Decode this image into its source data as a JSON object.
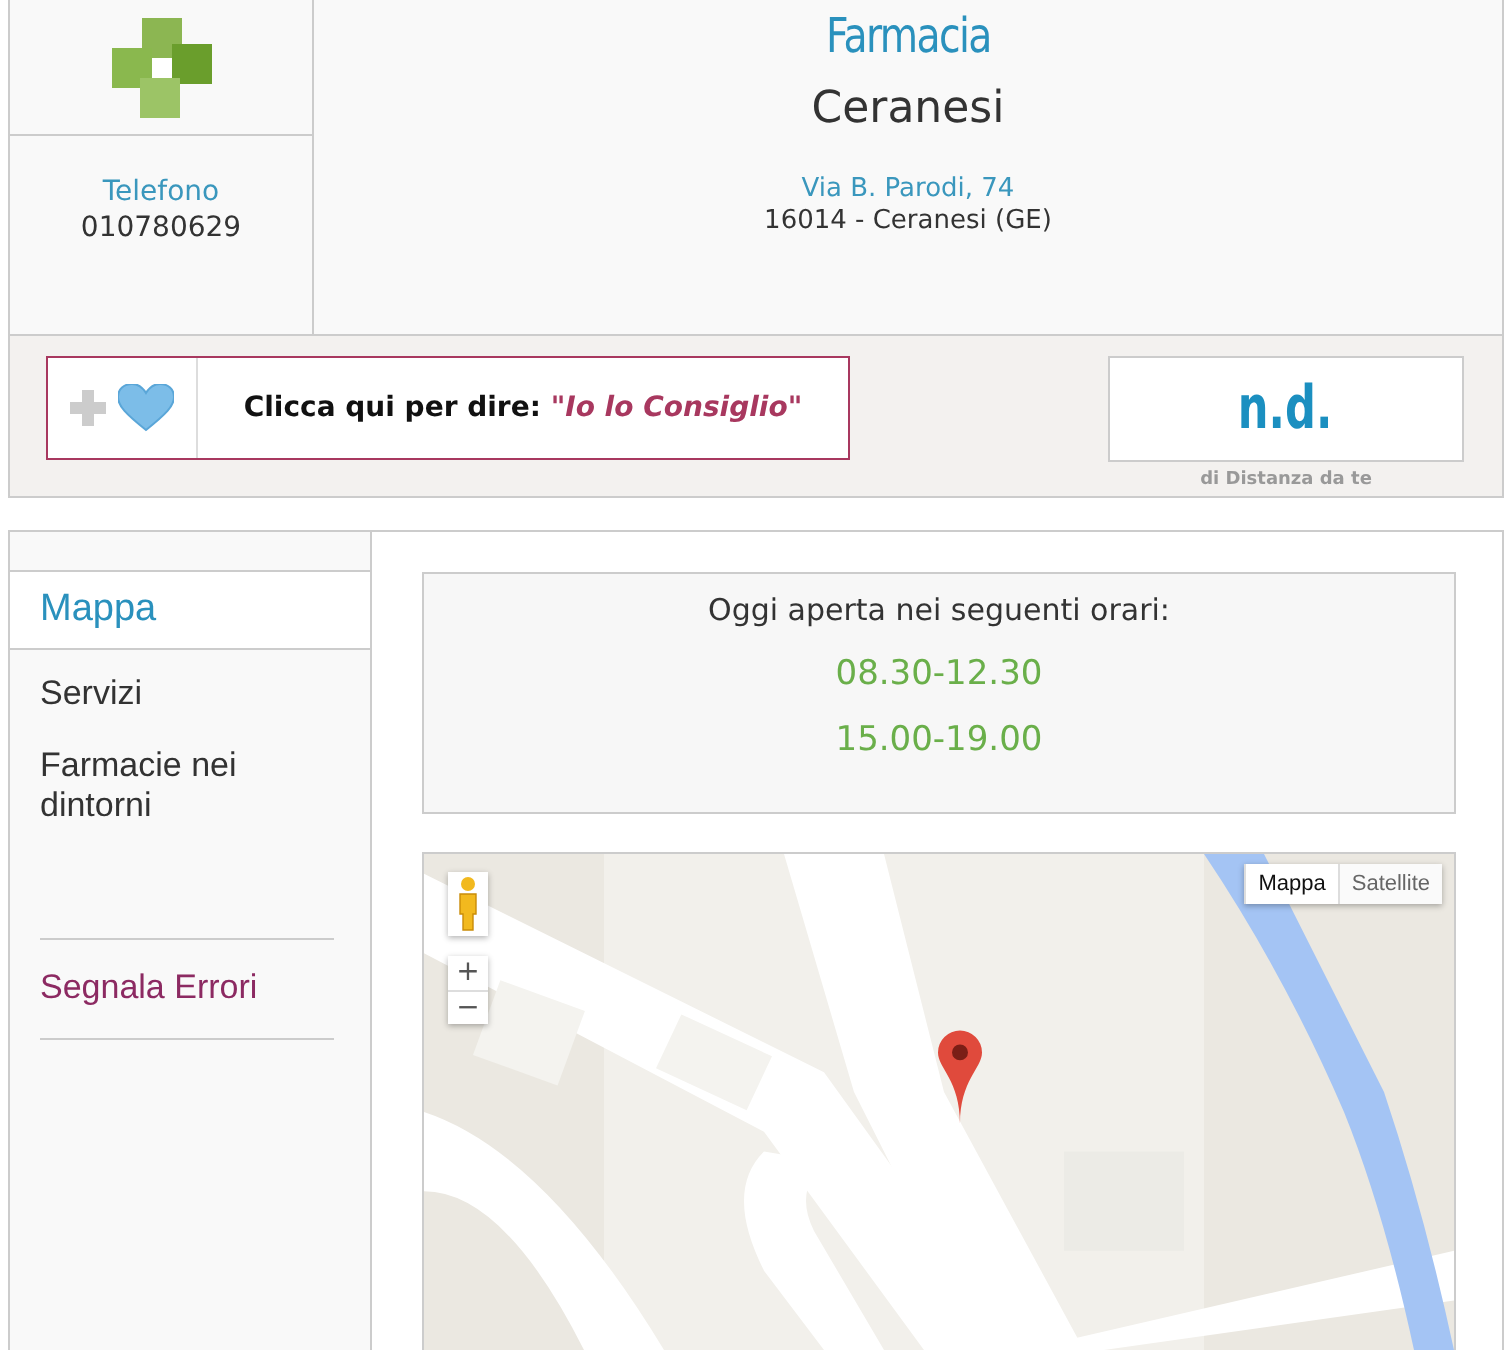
{
  "contact": {
    "label": "Telefono",
    "phone": "010780629"
  },
  "pharmacy": {
    "title": "Farmacia",
    "name": "Ceranesi",
    "street": "Via B. Parodi, 74",
    "city": "16014 - Ceranesi (GE)"
  },
  "recommend": {
    "text": "Clicca qui per dire:",
    "quote": "\"Io lo Consiglio\""
  },
  "distance": {
    "value": "n.d.",
    "caption": "di Distanza da te"
  },
  "sidebar": {
    "items": [
      {
        "label": "Mappa",
        "selected": true
      },
      {
        "label": "Servizi",
        "selected": false
      },
      {
        "label": "Farmacie nei dintorni",
        "selected": false
      }
    ],
    "report": "Segnala Errori"
  },
  "hours": {
    "title": "Oggi aperta nei seguenti orari:",
    "slots": [
      "08.30-12.30",
      "15.00-19.00"
    ]
  },
  "map": {
    "types": [
      {
        "label": "Mappa",
        "selected": true
      },
      {
        "label": "Satellite",
        "selected": false
      }
    ],
    "zoom_in": "+",
    "zoom_out": "−"
  }
}
